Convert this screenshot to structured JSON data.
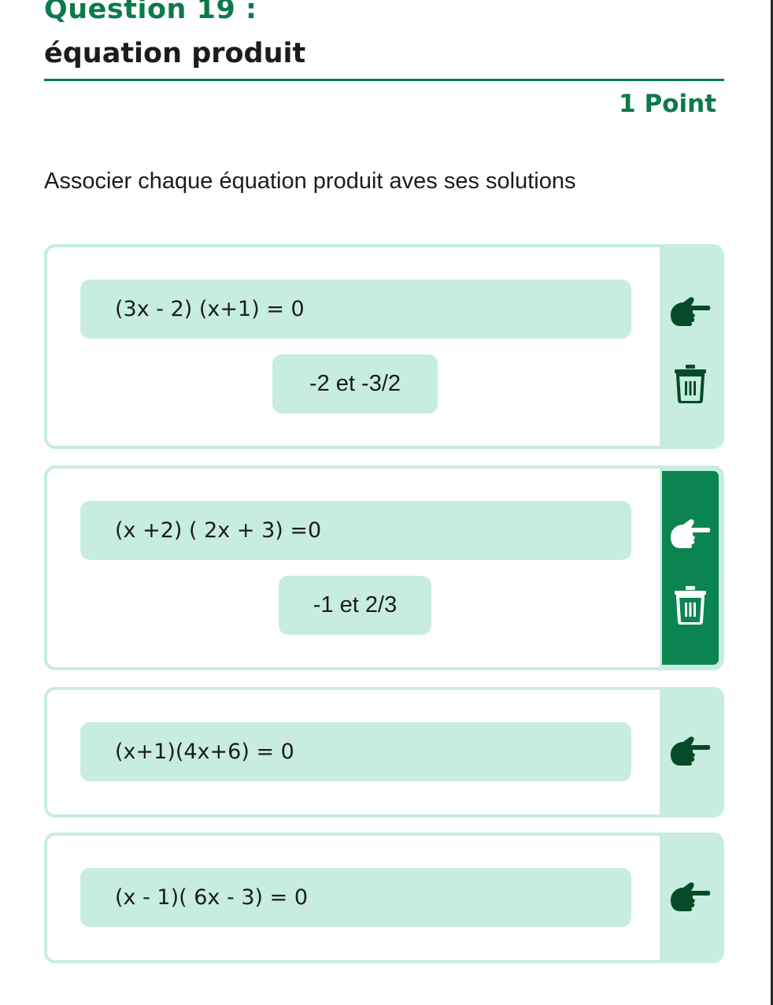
{
  "question": {
    "number": "Question 19 :",
    "title": "équation produit",
    "points": "1 Point",
    "instruction": "Associer chaque équation produit aves ses solutions"
  },
  "colors": {
    "accent": "#0b7a4a",
    "pill": "#c6ede0",
    "active_side": "#0b8450",
    "icon_dark": "#064a2a"
  },
  "cards": [
    {
      "equation": "(3x - 2) (x+1) = 0",
      "solution": "-2 et -3/2",
      "active": false,
      "hand_icon": "pointing-hand-icon",
      "remove_icon": "trash-icon"
    },
    {
      "equation": "(x +2) ( 2x + 3) =0",
      "solution": "-1 et 2/3",
      "active": true,
      "hand_icon": "pointing-hand-icon",
      "remove_icon": "trash-icon"
    },
    {
      "equation": "(x+1)(4x+6) = 0",
      "active": false,
      "hand_icon": "pointing-hand-icon"
    },
    {
      "equation": "(x - 1)( 6x - 3) = 0",
      "active": false,
      "hand_icon": "pointing-hand-icon"
    }
  ]
}
